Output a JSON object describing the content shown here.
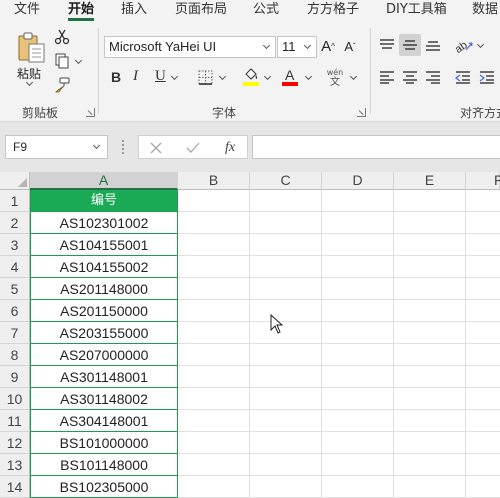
{
  "menu": {
    "tabs": [
      {
        "label": "文件"
      },
      {
        "label": "开始",
        "active": true
      },
      {
        "label": "插入"
      },
      {
        "label": "页面布局"
      },
      {
        "label": "公式"
      },
      {
        "label": "方方格子"
      },
      {
        "label": "DIY工具箱"
      },
      {
        "label": "数据"
      }
    ]
  },
  "ribbon": {
    "clipboard": {
      "paste_label": "粘贴",
      "group_label": "剪贴板"
    },
    "font": {
      "font_name": "Microsoft YaHei UI",
      "font_size": "11",
      "bold": "B",
      "italic": "I",
      "underline": "U",
      "phonetic_top": "wén",
      "phonetic_bottom": "文",
      "group_label": "字体",
      "fill_color": "#ffff00",
      "font_color": "#ff0000"
    },
    "alignment": {
      "group_label": "对齐方式"
    }
  },
  "formula_bar": {
    "name_box": "F9",
    "fx_label": "fx",
    "formula": ""
  },
  "sheet": {
    "columns": [
      "A",
      "B",
      "C",
      "D",
      "E",
      "F"
    ],
    "active_column": "A",
    "rows": [
      "1",
      "2",
      "3",
      "4",
      "5",
      "6",
      "7",
      "8",
      "9",
      "10",
      "11",
      "12",
      "13",
      "14"
    ],
    "column_a": [
      "编号",
      "AS102301002",
      "AS104155001",
      "AS104155002",
      "AS201148000",
      "AS201150000",
      "AS203155000",
      "AS207000000",
      "AS301148001",
      "AS301148002",
      "AS304148001",
      "BS101000000",
      "BS101148000",
      "BS102305000"
    ],
    "header_fill": "#1aaa55"
  }
}
